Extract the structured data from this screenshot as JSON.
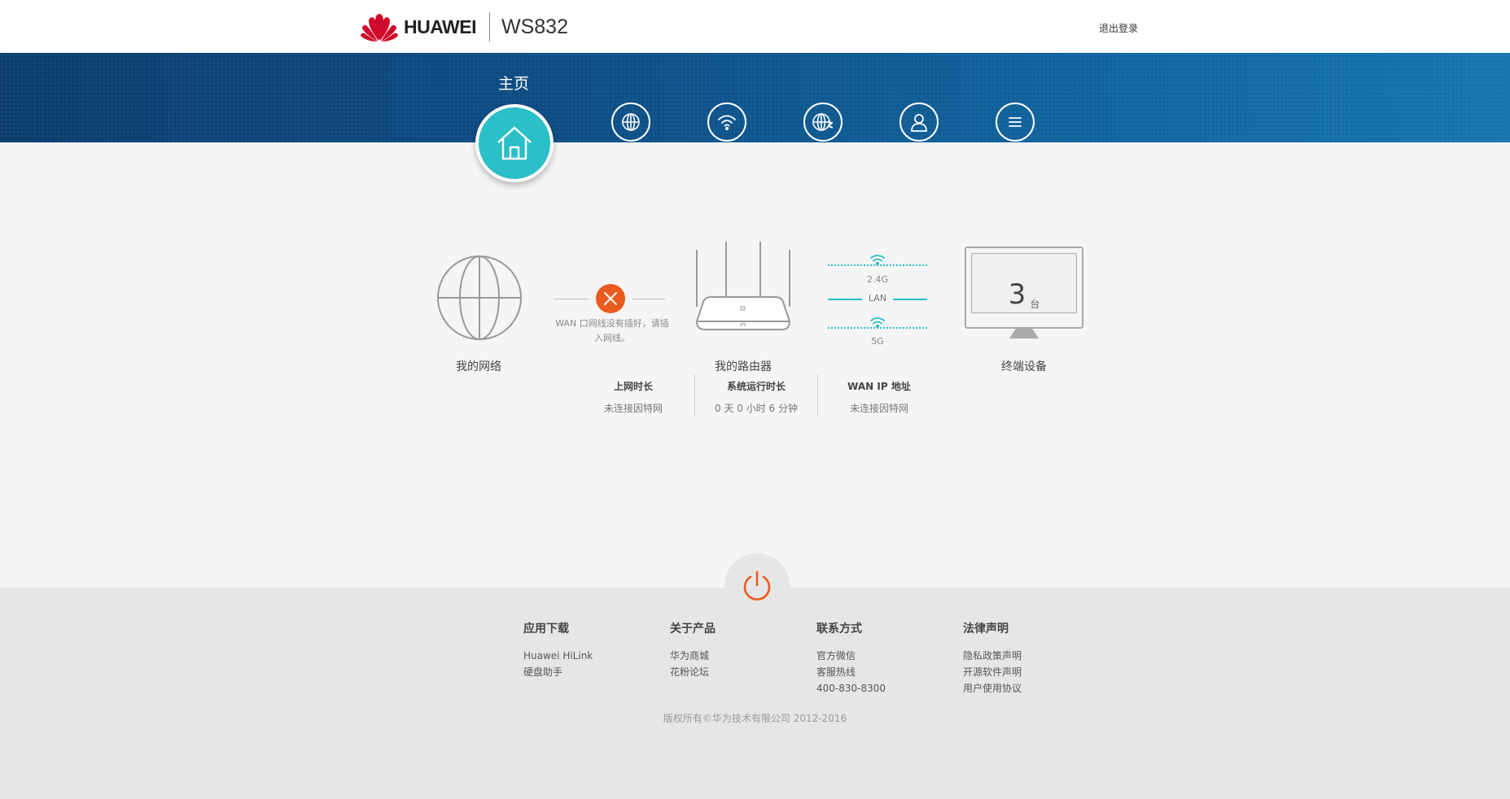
{
  "header": {
    "brand": "HUAWEI",
    "model": "WS832",
    "logout": "退出登录",
    "logo_icon": "huawei-flower-logo"
  },
  "nav": {
    "active_title": "主页",
    "items": [
      {
        "name": "home",
        "icon": "home-icon",
        "active": true
      },
      {
        "name": "internet",
        "icon": "globe-icon"
      },
      {
        "name": "wifi",
        "icon": "wifi-icon"
      },
      {
        "name": "network-settings",
        "icon": "globe-gear-icon"
      },
      {
        "name": "user",
        "icon": "user-icon"
      },
      {
        "name": "more",
        "icon": "menu-icon"
      }
    ]
  },
  "diagram": {
    "my_network": "我的网络",
    "wan_error": "WAN 口网线没有插好，请插入网线。",
    "router": "我的路由器",
    "band_24": "2.4G",
    "lan": "LAN",
    "band_5": "5G",
    "devices_count": "3",
    "devices_unit": "台",
    "devices_label": "终端设备"
  },
  "stats": [
    {
      "title": "上网时长",
      "value": "未连接因特网"
    },
    {
      "title": "系统运行时长",
      "value": "0 天 0 小时 6 分钟"
    },
    {
      "title": "WAN IP 地址",
      "value": "未连接因特网"
    }
  ],
  "footer": {
    "columns": [
      {
        "title": "应用下载",
        "links": [
          "Huawei HiLink",
          "硬盘助手"
        ]
      },
      {
        "title": "关于产品",
        "links": [
          "华为商城",
          "花粉论坛"
        ]
      },
      {
        "title": "联系方式",
        "links": [
          "官方微信",
          "客服热线",
          "400-830-8300"
        ]
      },
      {
        "title": "法律声明",
        "links": [
          "隐私政策声明",
          "开源软件声明",
          "用户使用协议"
        ]
      }
    ],
    "copyright": "版权所有©华为技术有限公司 2012-2016"
  },
  "colors": {
    "accent_teal": "#2bbfc7",
    "error_orange": "#ea5b1e",
    "nav_blue": "#0e4f86",
    "brand_red": "#cf0a2c"
  }
}
